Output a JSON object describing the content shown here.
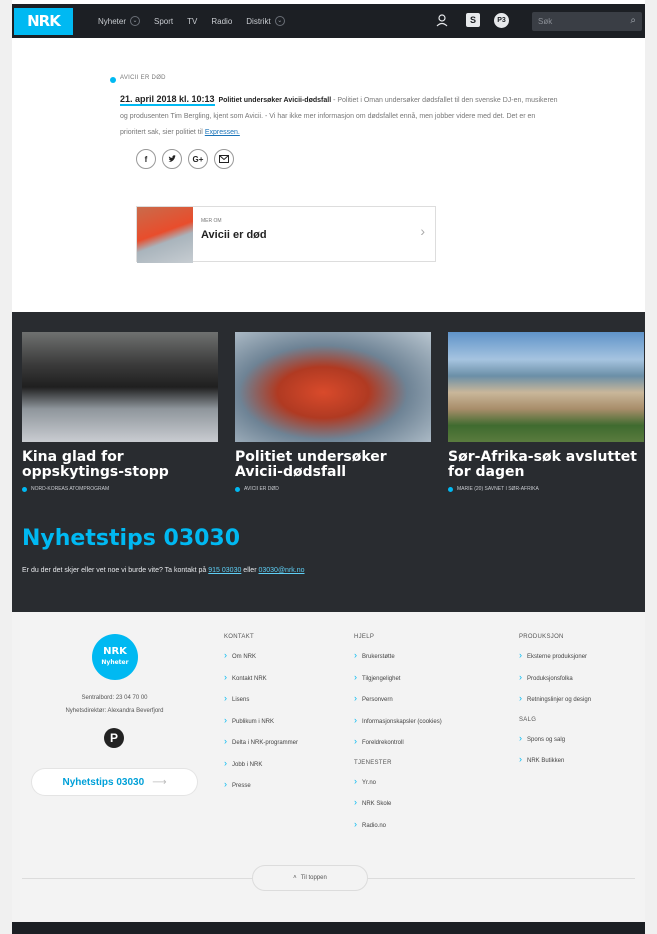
{
  "header": {
    "logo": "NRK",
    "nav": [
      {
        "label": "Nyheter",
        "has_dropdown": true
      },
      {
        "label": "Sport",
        "has_dropdown": false
      },
      {
        "label": "TV",
        "has_dropdown": false
      },
      {
        "label": "Radio",
        "has_dropdown": false
      },
      {
        "label": "Distrikt",
        "has_dropdown": true
      }
    ],
    "search_placeholder": "Søk",
    "icons": [
      "user-icon",
      "super-icon",
      "p3-icon",
      "search-icon"
    ]
  },
  "update": {
    "kicker": "AVICII ER DØD",
    "timestamp": "21. april 2018 kl. 10:13",
    "headline": "Politiet undersøker Avicii-dødsfall",
    "body": " - Politiet i Oman undersøker dødsfallet til den svenske DJ-en, musikeren og produsenten Tim Bergling, kjent som Avicii. - Vi har ikke mer informasjon om dødsfallet ennå, men jobber videre med det. Det er en prioritert sak, sier politiet til ",
    "source_link": "Expressen.",
    "share": [
      "f",
      "t",
      "G+",
      "@"
    ],
    "card": {
      "kicker": "MER OM",
      "title": "Avicii er død"
    }
  },
  "teasers": [
    {
      "title": "Kina glad for oppskytings-stopp",
      "kicker": "NORD-KOREAS ATOMPROGRAM"
    },
    {
      "title": "Politiet undersøker Avicii-dødsfall",
      "kicker": "AVICII ER DØD"
    },
    {
      "title": "Sør-Afrika-søk avsluttet for dagen",
      "kicker": "MARIE (20) SAVNET I SØR-AFRIKA"
    }
  ],
  "tips": {
    "title": "Nyhetstips 03030",
    "text_before": "Er du der det skjer eller vet noe vi burde vite? Ta kontakt på ",
    "sms": "915 03030",
    "text_middle": " eller ",
    "email": "03030@nrk.no"
  },
  "footer": {
    "logo_top": "NRK",
    "logo_bottom": "Nyheter",
    "switchboard": "Sentralbord: 23 04 70 00",
    "editor": "Nyhetsdirektør: Alexandra Beverfjord",
    "tips_button": "Nyhetstips 03030",
    "col1": {
      "heading": "KONTAKT",
      "items": [
        "Om NRK",
        "Kontakt NRK",
        "Lisens",
        "Publikum i NRK",
        "Delta i NRK-programmer",
        "Jobb i NRK",
        "Presse"
      ]
    },
    "col2": {
      "heading": "HJELP",
      "items": [
        "Brukerstøtte",
        "Tilgjengelighet",
        "Personvern",
        "Informasjonskapsler (cookies)",
        "Foreldrekontroll"
      ],
      "heading2": "TJENESTER",
      "items2": [
        "Yr.no",
        "NRK Skole",
        "Radio.no"
      ]
    },
    "col3": {
      "heading": "PRODUKSJON",
      "items": [
        "Eksterne produksjoner",
        "Produksjonsfolka",
        "Retningslinjer og design"
      ],
      "heading2": "SALG",
      "items2": [
        "Spons og salg",
        "NRK Butikken"
      ]
    },
    "to_top": "Til toppen"
  }
}
